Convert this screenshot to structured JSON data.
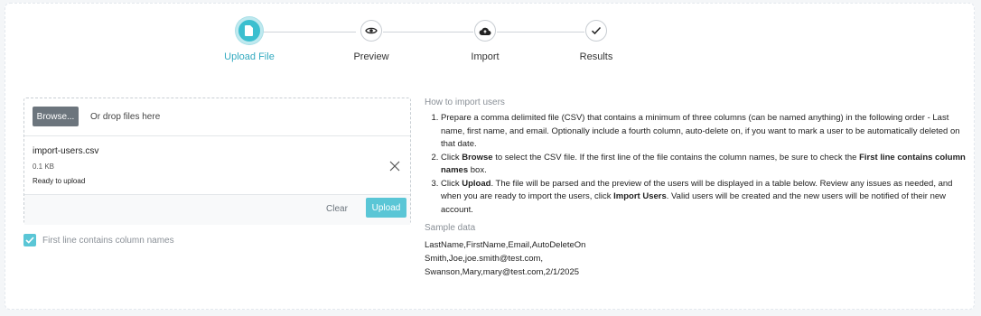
{
  "stepper": {
    "steps": [
      {
        "label": "Upload File",
        "icon": "file-icon",
        "active": true
      },
      {
        "label": "Preview",
        "icon": "eye-icon",
        "active": false
      },
      {
        "label": "Import",
        "icon": "cloud-upload-icon",
        "active": false
      },
      {
        "label": "Results",
        "icon": "check-icon",
        "active": false
      }
    ]
  },
  "upload": {
    "browse_label": "Browse...",
    "drop_text": "Or drop files here",
    "file": {
      "name": "import-users.csv",
      "size": "0.1 KB",
      "status": "Ready to upload"
    },
    "clear_label": "Clear",
    "upload_label": "Upload",
    "first_line_checkbox": {
      "label": "First line contains column names",
      "checked": true
    }
  },
  "instructions": {
    "title": "How to import users",
    "step1": "Prepare a comma delimited file (CSV) that contains a minimum of three columns (can be named anything) in the following order - Last name, first name, and email. Optionally include a fourth column, auto-delete on, if you want to mark a user to be automatically deleted on that date.",
    "step2_a": "Click ",
    "step2_b": "Browse",
    "step2_c": " to select the CSV file. If the first line of the file contains the column names, be sure to check the ",
    "step2_d": "First line contains column names",
    "step2_e": " box.",
    "step3_a": "Click ",
    "step3_b": "Upload",
    "step3_c": ". The file will be parsed and the preview of the users will be displayed in a table below. Review any issues as needed, and when you are ready to import the users, click ",
    "step3_d": "Import Users",
    "step3_e": ". Valid users will be created and the new users will be notified of their new account."
  },
  "sample": {
    "title": "Sample data",
    "lines": [
      "LastName,FirstName,Email,AutoDeleteOn",
      "Smith,Joe,joe.smith@test.com,",
      "Swanson,Mary,mary@test.com,2/1/2025"
    ]
  },
  "colors": {
    "accent": "#3bbfcf",
    "upload_button": "#5ac6d6",
    "browse_button": "#6c757d"
  }
}
